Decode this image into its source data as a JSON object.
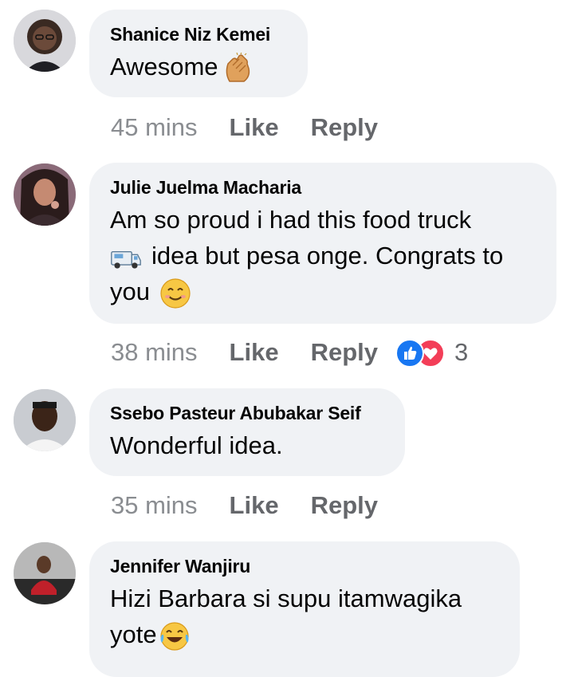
{
  "comments": [
    {
      "author": "Shanice Niz Kemei",
      "text": "Awesome",
      "emoji": "clapping-hands-icon",
      "time": "45 mins",
      "like_label": "Like",
      "reply_label": "Reply"
    },
    {
      "author": "Julie Juelma Macharia",
      "text_line1": "Am so proud i had this food truck",
      "text_line2": "idea but pesa onge. Congrats to",
      "text_line3": "you",
      "emoji_inline": "delivery-truck-icon",
      "emoji_end": "smiling-face-icon",
      "time": "38 mins",
      "like_label": "Like",
      "reply_label": "Reply",
      "reactions": [
        "like-reaction-icon",
        "love-reaction-icon"
      ],
      "reaction_count": "3"
    },
    {
      "author": "Ssebo Pasteur Abubakar Seif",
      "text": "Wonderful idea.",
      "time": "35 mins",
      "like_label": "Like",
      "reply_label": "Reply"
    },
    {
      "author": "Jennifer Wanjiru",
      "text_line1": "Hizi Barbara si supu itamwagika",
      "text_line2": "yote",
      "emoji": "tears-of-joy-icon"
    }
  ],
  "colors": {
    "bubble": "#f0f2f5",
    "meta_text": "#65676b",
    "like_blue": "#1877f2",
    "love_red": "#f33e58"
  }
}
